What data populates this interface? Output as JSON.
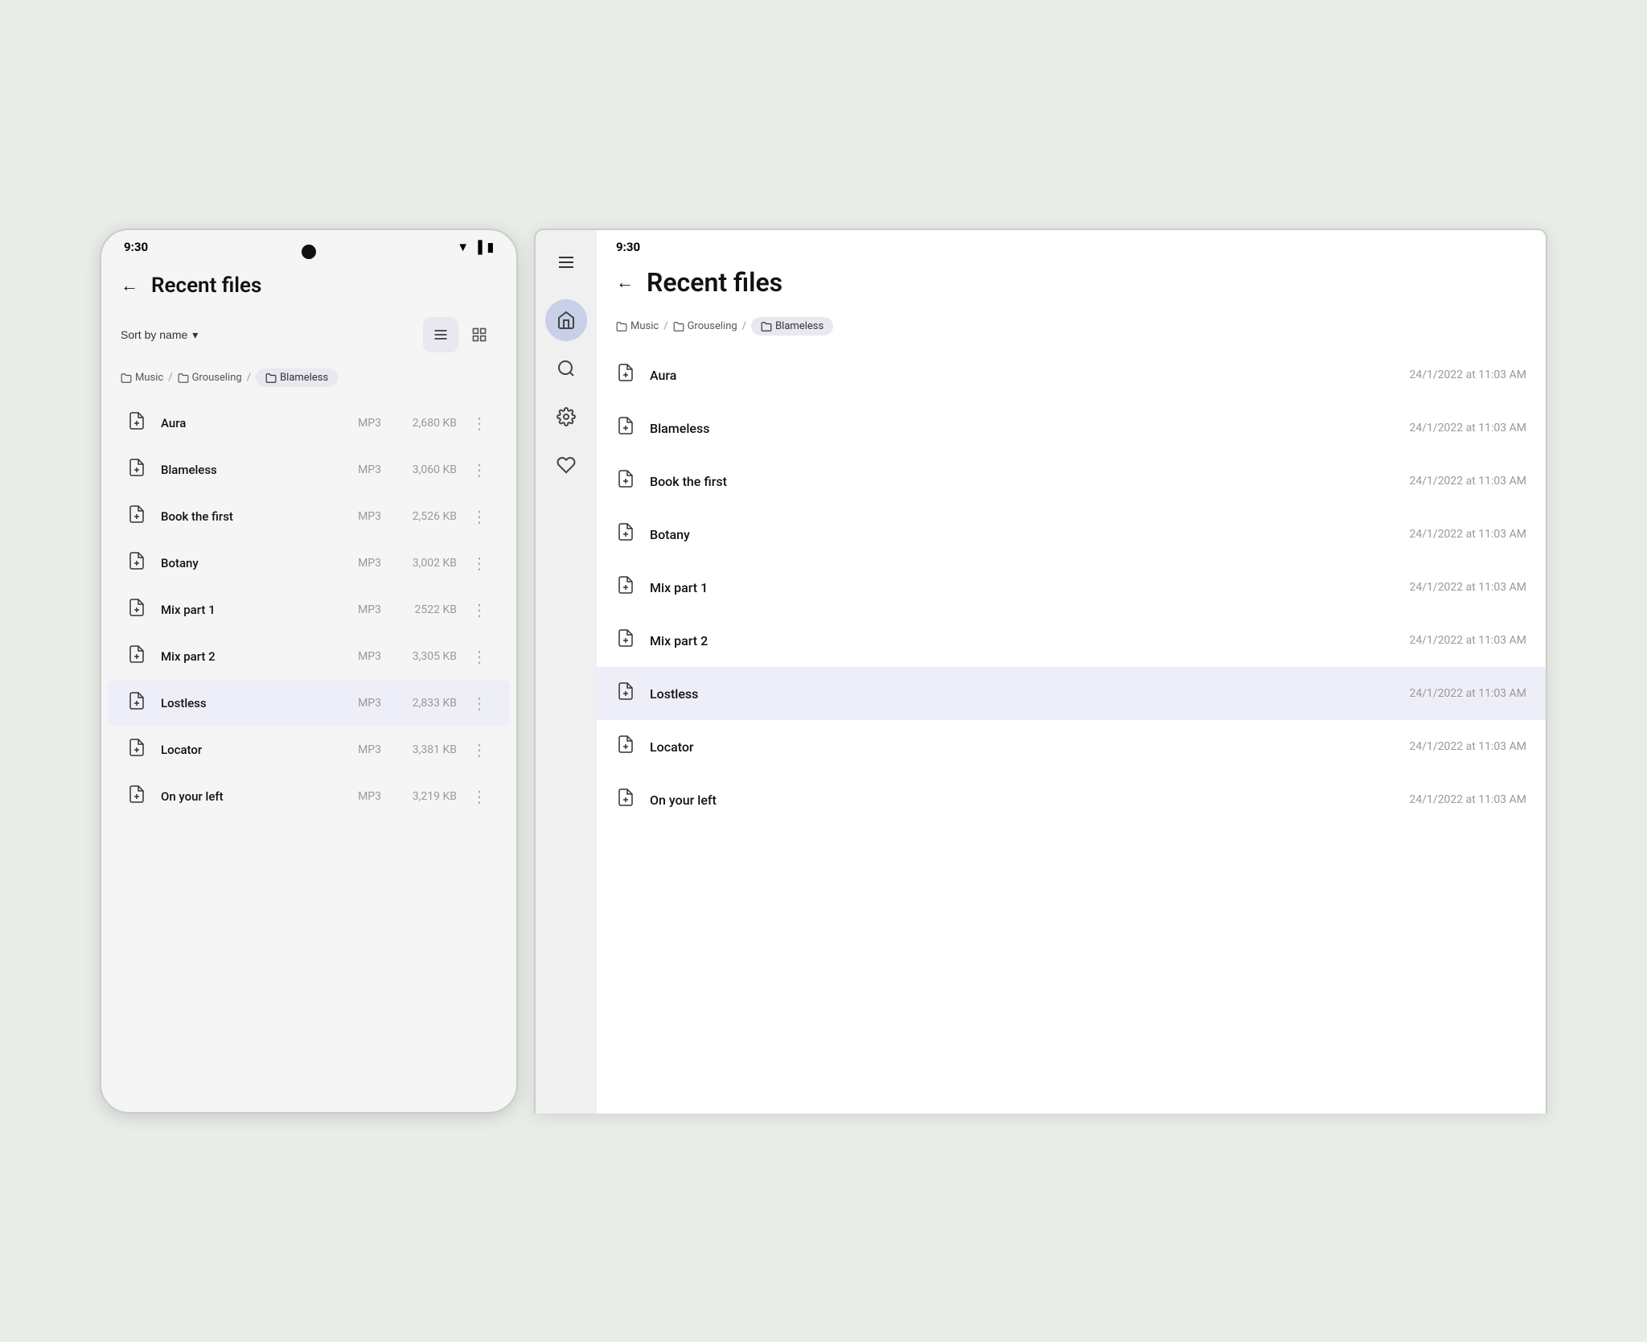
{
  "colors": {
    "background": "#e8ede8",
    "surface": "#ffffff",
    "selected": "#eeeef8",
    "breadcrumb_active": "#e8e8f0",
    "sidebar_active": "#c8d0e8",
    "text_primary": "#111111",
    "text_secondary": "#999999",
    "accent": "#5c5f8a"
  },
  "phone": {
    "status_time": "9:30",
    "page_title": "Recent files",
    "sort_label": "Sort by name",
    "sort_icon": "▾",
    "back_arrow": "←"
  },
  "tablet": {
    "status_time": "9:30",
    "page_title": "Recent files",
    "back_arrow": "←"
  },
  "breadcrumb": {
    "items": [
      {
        "label": "Music",
        "icon": "folder",
        "active": false
      },
      {
        "label": "Grouseling",
        "icon": "folder",
        "active": false
      },
      {
        "label": "Blameless",
        "icon": "folder",
        "active": true
      }
    ],
    "separator": "/"
  },
  "files": [
    {
      "name": "Aura",
      "type": "MP3",
      "size": "2,680 KB",
      "date": "24/1/2022 at 11:03 AM",
      "selected": false
    },
    {
      "name": "Blameless",
      "type": "MP3",
      "size": "3,060 KB",
      "date": "24/1/2022 at 11:03 AM",
      "selected": false
    },
    {
      "name": "Book the first",
      "type": "MP3",
      "size": "2,526 KB",
      "date": "24/1/2022 at 11:03 AM",
      "selected": false
    },
    {
      "name": "Botany",
      "type": "MP3",
      "size": "3,002 KB",
      "date": "24/1/2022 at 11:03 AM",
      "selected": false
    },
    {
      "name": "Mix part 1",
      "type": "MP3",
      "size": "2522 KB",
      "date": "24/1/2022 at 11:03 AM",
      "selected": false
    },
    {
      "name": "Mix part 2",
      "type": "MP3",
      "size": "3,305 KB",
      "date": "24/1/2022 at 11:03 AM",
      "selected": false
    },
    {
      "name": "Lostless",
      "type": "MP3",
      "size": "2,833 KB",
      "date": "24/1/2022 at 11:03 AM",
      "selected": true
    },
    {
      "name": "Locator",
      "type": "MP3",
      "size": "3,381 KB",
      "date": "24/1/2022 at 11:03 AM",
      "selected": false
    },
    {
      "name": "On your left",
      "type": "MP3",
      "size": "3,219 KB",
      "date": "24/1/2022 at 11:03 AM",
      "selected": false
    }
  ],
  "sidebar": {
    "items": [
      {
        "icon": "home",
        "label": "Home",
        "active": true
      },
      {
        "icon": "search",
        "label": "Search",
        "active": false
      },
      {
        "icon": "settings",
        "label": "Settings",
        "active": false
      },
      {
        "icon": "heart",
        "label": "Favorites",
        "active": false
      }
    ]
  },
  "view_toggle": {
    "list_label": "List view",
    "grid_label": "Grid view",
    "active": "list"
  }
}
